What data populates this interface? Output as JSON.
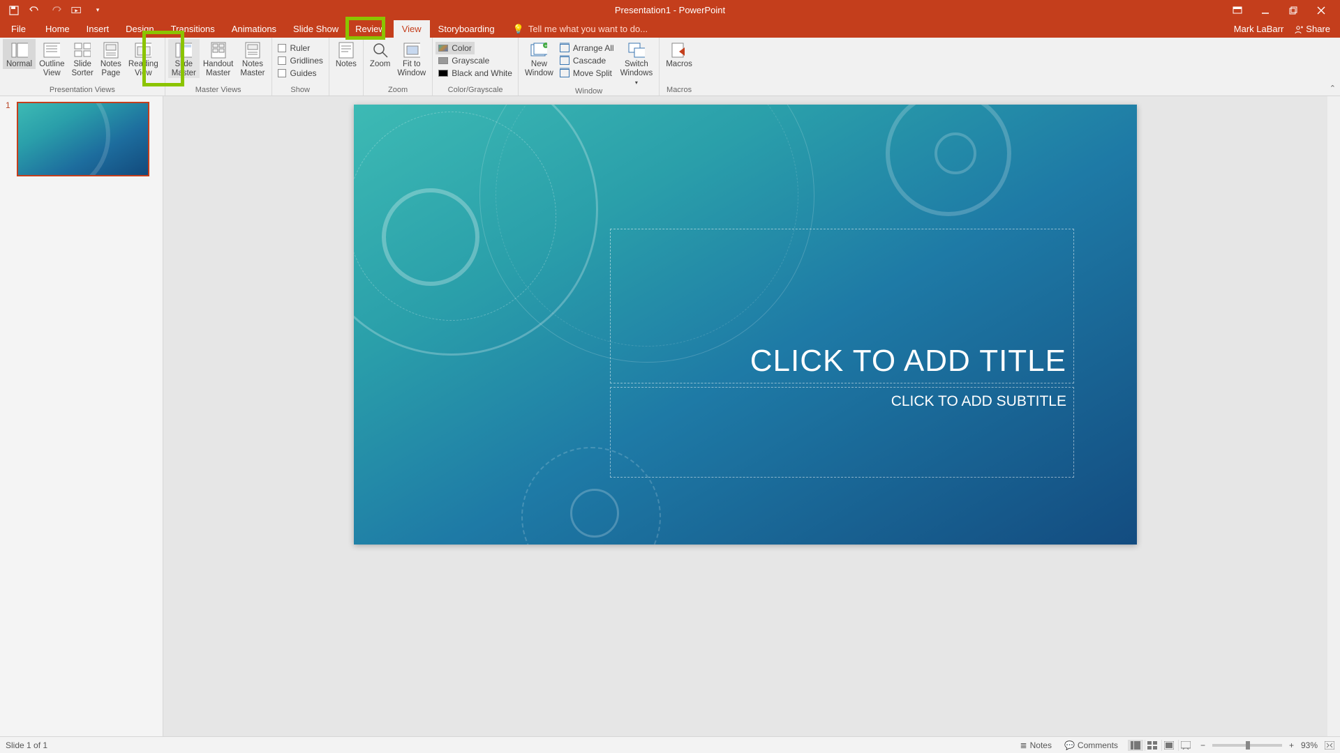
{
  "title": "Presentation1 - PowerPoint",
  "user": "Mark LaBarr",
  "share_label": "Share",
  "tabs": {
    "file": "File",
    "home": "Home",
    "insert": "Insert",
    "design": "Design",
    "transitions": "Transitions",
    "animations": "Animations",
    "slideshow": "Slide Show",
    "review": "Review",
    "view": "View",
    "storyboarding": "Storyboarding"
  },
  "tellme_placeholder": "Tell me what you want to do...",
  "ribbon": {
    "presentation_views": {
      "label": "Presentation Views",
      "normal": "Normal",
      "outline_view": "Outline\nView",
      "slide_sorter": "Slide\nSorter",
      "notes_page": "Notes\nPage",
      "reading_view": "Reading\nView"
    },
    "master_views": {
      "label": "Master Views",
      "slide_master": "Slide\nMaster",
      "handout_master": "Handout\nMaster",
      "notes_master": "Notes\nMaster"
    },
    "show": {
      "label": "Show",
      "ruler": "Ruler",
      "gridlines": "Gridlines",
      "guides": "Guides"
    },
    "notes_btn": "Notes",
    "zoom": {
      "label": "Zoom",
      "zoom_btn": "Zoom",
      "fit": "Fit to\nWindow"
    },
    "color_grayscale": {
      "label": "Color/Grayscale",
      "color": "Color",
      "grayscale": "Grayscale",
      "bw": "Black and White"
    },
    "window": {
      "label": "Window",
      "new_window": "New\nWindow",
      "arrange_all": "Arrange All",
      "cascade": "Cascade",
      "move_split": "Move Split",
      "switch": "Switch\nWindows"
    },
    "macros": {
      "label": "Macros",
      "btn": "Macros"
    }
  },
  "thumb": {
    "number": "1"
  },
  "slide": {
    "title_placeholder": "CLICK TO ADD TITLE",
    "subtitle_placeholder": "CLICK TO ADD SUBTITLE"
  },
  "status": {
    "slide_info": "Slide 1 of 1",
    "notes": "Notes",
    "comments": "Comments",
    "zoom": "93%"
  }
}
